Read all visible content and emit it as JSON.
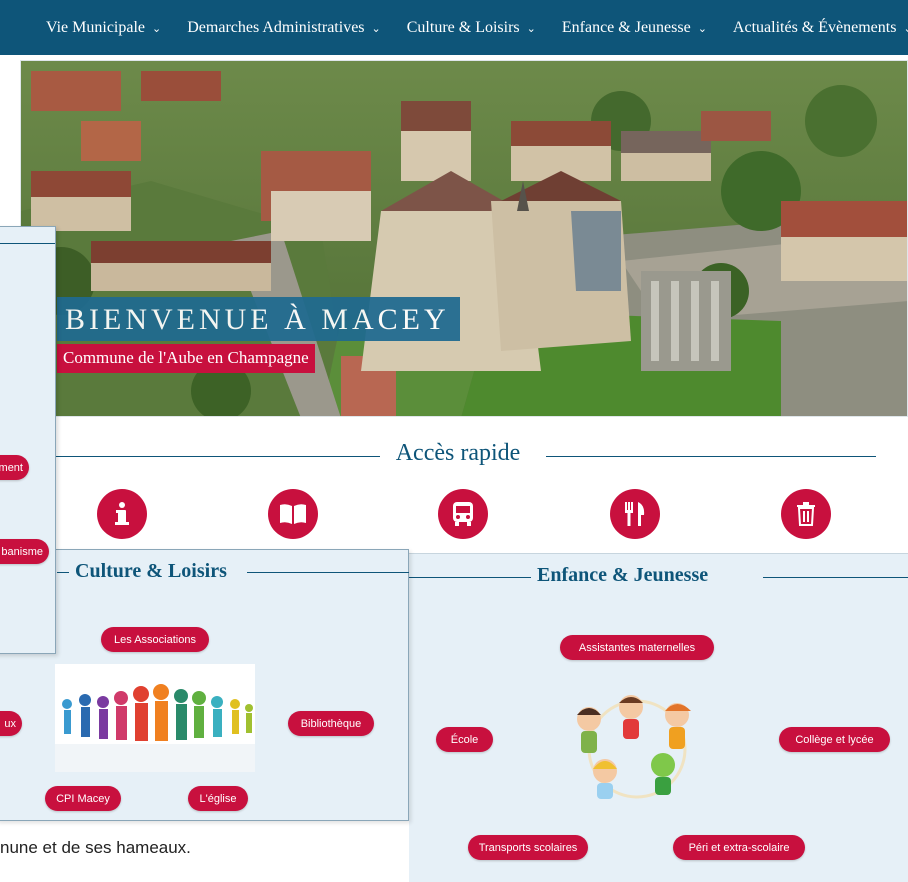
{
  "nav": {
    "items": [
      {
        "label": "Vie Municipale"
      },
      {
        "label": "Demarches Administratives"
      },
      {
        "label": "Culture & Loisirs"
      },
      {
        "label": "Enfance & Jeunesse"
      },
      {
        "label": "Actualités & Évènements"
      }
    ],
    "chevron": "⌄"
  },
  "hero": {
    "title": "BIENVENUE À MACEY",
    "subtitle": "Commune de l'Aube en Champagne"
  },
  "quick_access": {
    "title": "Accès rapide",
    "icons": [
      "info-icon",
      "book-icon",
      "bus-icon",
      "restaurant-icon",
      "trash-icon"
    ]
  },
  "demarches_panel": {
    "buttons": [
      "ment",
      "banisme"
    ]
  },
  "culture": {
    "title": "Culture & Loisirs",
    "buttons": {
      "associations": "Les Associations",
      "left": "ux",
      "bibliotheque": "Bibliothèque",
      "cpi": "CPI Macey",
      "eglise": "L'église"
    }
  },
  "enfance": {
    "title": "Enfance & Jeunesse",
    "buttons": {
      "assistantes": "Assistantes maternelles",
      "ecole": "École",
      "college": "Collège et lycée",
      "transports": "Transports scolaires",
      "peri": "Péri et extra-scolaire"
    }
  },
  "footer_text": "nune et de ses hameaux.",
  "colors": {
    "nav": "#0e5579",
    "accent": "#c8103e",
    "panel": "#e6f0f7"
  }
}
